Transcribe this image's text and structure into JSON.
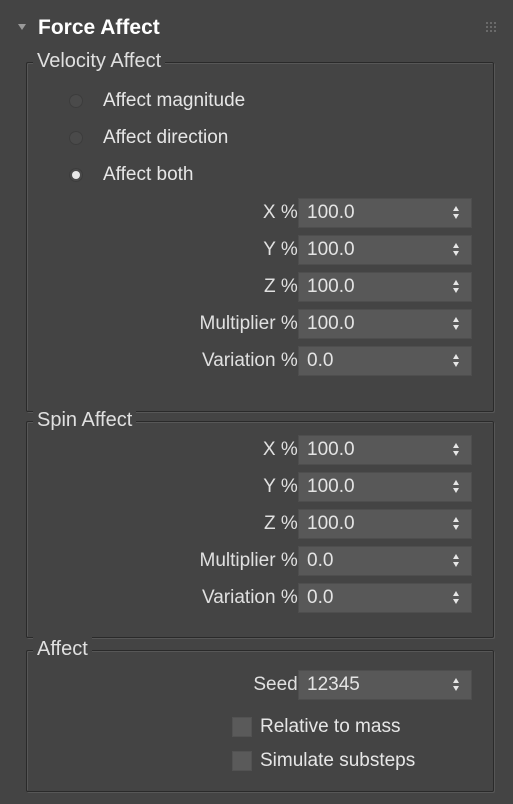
{
  "rollout": {
    "title": "Force Affect"
  },
  "velocity_group": {
    "title": "Velocity Affect",
    "radios": [
      {
        "label": "Affect magnitude",
        "checked": false
      },
      {
        "label": "Affect direction",
        "checked": false
      },
      {
        "label": "Affect both",
        "checked": true
      }
    ],
    "fields": [
      {
        "label": "X %:",
        "value": "100.0"
      },
      {
        "label": "Y %:",
        "value": "100.0"
      },
      {
        "label": "Z %:",
        "value": "100.0"
      },
      {
        "label": "Multiplier %:",
        "value": "100.0"
      },
      {
        "label": "Variation %:",
        "value": "0.0"
      }
    ]
  },
  "spin_group": {
    "title": "Spin Affect",
    "fields": [
      {
        "label": "X %:",
        "value": "100.0"
      },
      {
        "label": "Y %:",
        "value": "100.0"
      },
      {
        "label": "Z %:",
        "value": "100.0"
      },
      {
        "label": "Multiplier %:",
        "value": "0.0"
      },
      {
        "label": "Variation %:",
        "value": "0.0"
      }
    ]
  },
  "affect_group": {
    "title": "Affect",
    "seed": {
      "label": "Seed:",
      "value": "12345"
    },
    "checkboxes": [
      {
        "label": "Relative to mass",
        "checked": false
      },
      {
        "label": "Simulate substeps",
        "checked": false
      }
    ]
  },
  "icons": {
    "collapse": "collapse-triangle-icon",
    "grip": "drag-grip-icon",
    "spinner": "spinner-arrows-icon"
  },
  "colors": {
    "panel_bg": "#444444",
    "field_bg": "#585858",
    "title_text": "#ffffff",
    "label_text": "#e0e0e0"
  }
}
